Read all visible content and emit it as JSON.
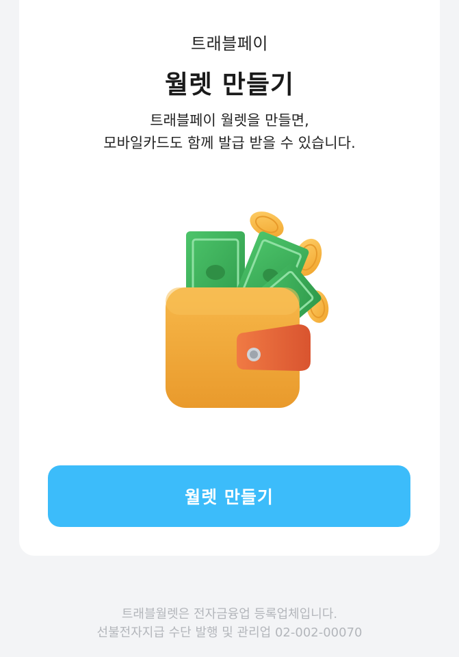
{
  "card": {
    "service_name": "트래블페이",
    "title": "월렛 만들기",
    "description_line1": "트래블페이 월렛을 만들면,",
    "description_line2": "모바일카드도 함께 발급 받을 수 있습니다.",
    "illustration_icon": "wallet-with-cash-and-coins-icon",
    "create_button_label": "월렛 만들기"
  },
  "footer": {
    "line1": "트래블월렛은 전자금융업 등록업체입니다.",
    "line2": "선불전자지급 수단 발행 및 관리업 02-002-00070"
  },
  "colors": {
    "background": "#f3f4f6",
    "card": "#ffffff",
    "button": "#3cbcfa",
    "wallet": "#f2a93b",
    "strap": "#e8643a",
    "cash": "#3fae5a",
    "coin": "#f6b73c",
    "footer_text": "#b3b6bb"
  }
}
